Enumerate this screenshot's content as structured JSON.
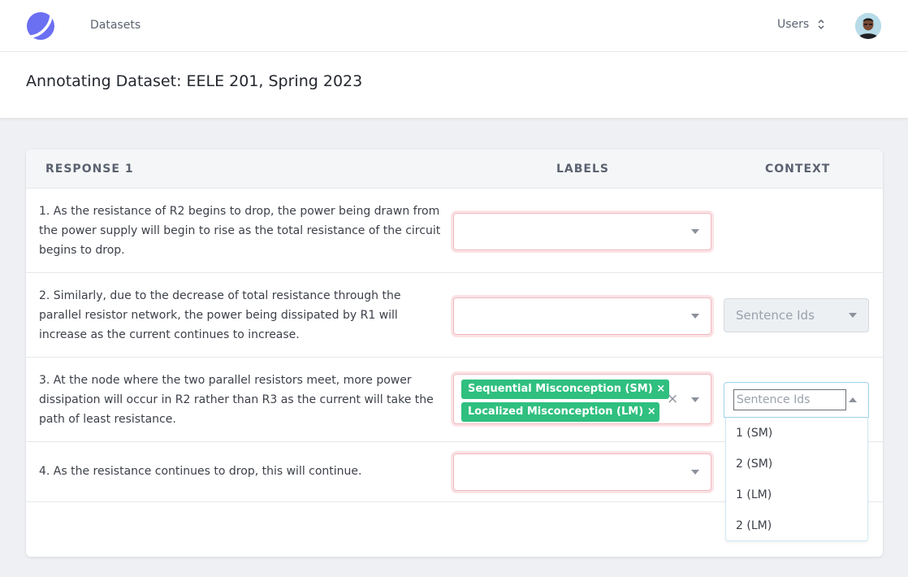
{
  "nav": {
    "datasets_label": "Datasets",
    "users_label": "Users"
  },
  "header": {
    "title": "Annotating Dataset: EELE 201, Spring 2023"
  },
  "table": {
    "columns": {
      "response": "RESPONSE 1",
      "labels": "LABELS",
      "context": "CONTEXT"
    },
    "rows": [
      {
        "text": "1. As the resistance of R2 begins to drop, the power being drawn from the power supply will begin to rise as the total resistance of the circuit begins to drop."
      },
      {
        "text": "2. Similarly, due to the decrease of total resistance through the parallel resistor network, the power being dissipated by R1 will increase as the current continues to increase.",
        "context_placeholder": "Sentence Ids"
      },
      {
        "text": "3. At the node where the two parallel resistors meet, more power dissipation will occur in R2 rather than R3 as the current will take the path of least resistance.",
        "tags": [
          "Sequential Misconception (SM)",
          "Localized Misconception (LM)"
        ],
        "tag_remove": "×",
        "clear": "×",
        "context_placeholder": "Sentence Ids",
        "context_options": [
          "1 (SM)",
          "2 (SM)",
          "1 (LM)",
          "2 (LM)"
        ]
      },
      {
        "text": "4. As the resistance continues to drop, this will continue."
      }
    ]
  },
  "colors": {
    "tag_green": "#2fbf7f",
    "invalid_border": "#f0b8bd",
    "focus_blue": "#9fd3ec"
  }
}
